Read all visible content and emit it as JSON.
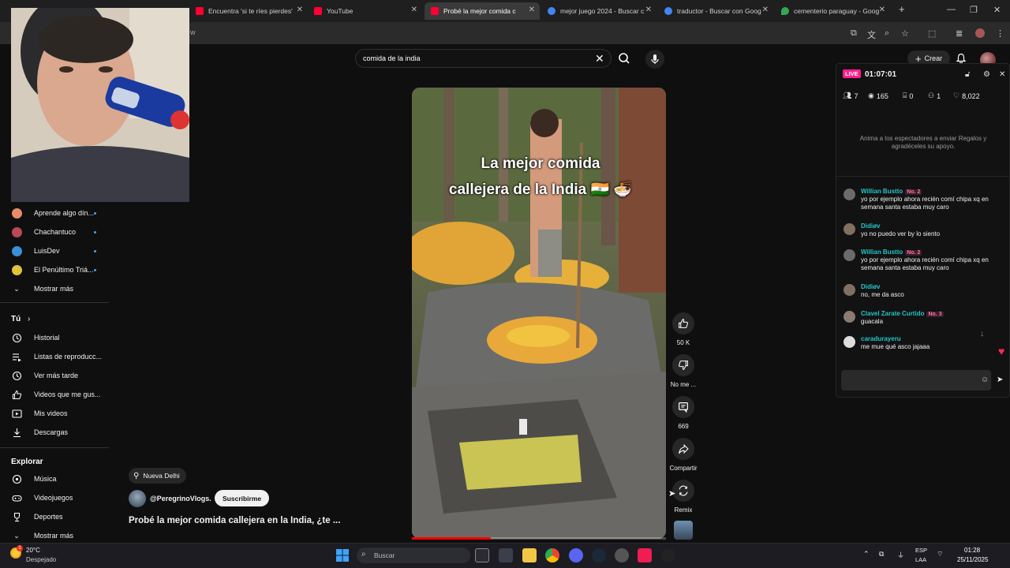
{
  "browser": {
    "tabs": [
      {
        "label": "Encuentra 'si te ríes pierdes'",
        "color": "#ff0033"
      },
      {
        "label": "YouTube",
        "color": "#ff0033"
      },
      {
        "label": "Probé la mejor comida c",
        "color": "#ff0033",
        "active": true
      },
      {
        "label": "mejor juego 2024 - Buscar c",
        "color": "#4285f4"
      },
      {
        "label": "traductor - Buscar con Goog",
        "color": "#4285f4"
      },
      {
        "label": "cementerio paraguay - Goog",
        "color": "#34a853"
      }
    ],
    "new_tab": "+",
    "address_fragment": "w"
  },
  "youtube": {
    "search": {
      "value": "comida de la india"
    },
    "create_label": "Crear",
    "sidebar": {
      "channels": [
        {
          "name": "Aprende algo dín...",
          "color": "#e98b6b"
        },
        {
          "name": "Chachantuco",
          "color": "#b84a55"
        },
        {
          "name": "LuisDev",
          "color": "#3a8fd8"
        },
        {
          "name": "El Penúltimo Triá...",
          "color": "#e0c23b"
        }
      ],
      "show_more_1": "Mostrar más",
      "you_header": "Tú",
      "you_items": [
        {
          "label": "Historial",
          "icon": "history-icon"
        },
        {
          "label": "Listas de reproducc...",
          "icon": "playlist-icon"
        },
        {
          "label": "Ver más tarde",
          "icon": "clock-icon"
        },
        {
          "label": "Videos que me gus...",
          "icon": "like-icon"
        },
        {
          "label": "Mis videos",
          "icon": "my-videos-icon"
        },
        {
          "label": "Descargas",
          "icon": "download-icon"
        }
      ],
      "explore_header": "Explorar",
      "explore_items": [
        {
          "label": "Música",
          "icon": "music-icon"
        },
        {
          "label": "Videojuegos",
          "icon": "gamepad-icon"
        },
        {
          "label": "Deportes",
          "icon": "trophy-icon"
        }
      ],
      "show_more_2": "Mostrar más"
    },
    "video": {
      "overlay_line1": "La mejor comida",
      "overlay_line2": "callejera de la India 🇮🇳 🍜",
      "location": "Nueva Delhi",
      "channel": "@PeregrinoVlogs.",
      "subscribe": "Suscribirme",
      "title": "Probé la mejor comida callejera en la India, ¿te ...",
      "progress": 0.31
    },
    "actions": {
      "likes": "50 K",
      "dislike": "No me ...",
      "comments": "669",
      "share": "Compartir",
      "remix": "Remix"
    }
  },
  "live": {
    "badge": "LIVE",
    "time": "01:07:01",
    "stats": {
      "members": "7",
      "views": "165",
      "gifts": "0",
      "followers": "1",
      "likes": "8,022"
    },
    "hint": "Anima a los espectadores a enviar Regalos y agradéceles su apoyo.",
    "messages": [
      {
        "user": "Willian Bustto",
        "rank": "No. 2",
        "text": "yo por ejemplo ahora recién comí chipa xq en semana santa estaba muy caro"
      },
      {
        "user": "Didiøv",
        "rank": "",
        "text": "yo no puedo ver by lo siento"
      },
      {
        "user": "Willian Bustto",
        "rank": "No. 2",
        "text": "yo por ejemplo ahora recién comí chipa xq en semana santa estaba muy caro"
      },
      {
        "user": "Didiøv",
        "rank": "",
        "text": "no, me da asco"
      },
      {
        "user": "Clavel Zarate Curtido",
        "rank": "No. 3",
        "text": "guacala"
      },
      {
        "user": "caradurayeru",
        "rank": "",
        "text": "me mue qué asco jajaaa"
      }
    ]
  },
  "taskbar": {
    "weather_temp": "20°C",
    "weather_desc": "Despejado",
    "search_placeholder": "Buscar",
    "lang": "ESP",
    "lang2": "LAA",
    "time": "01:28",
    "date": "25/11/2025"
  }
}
